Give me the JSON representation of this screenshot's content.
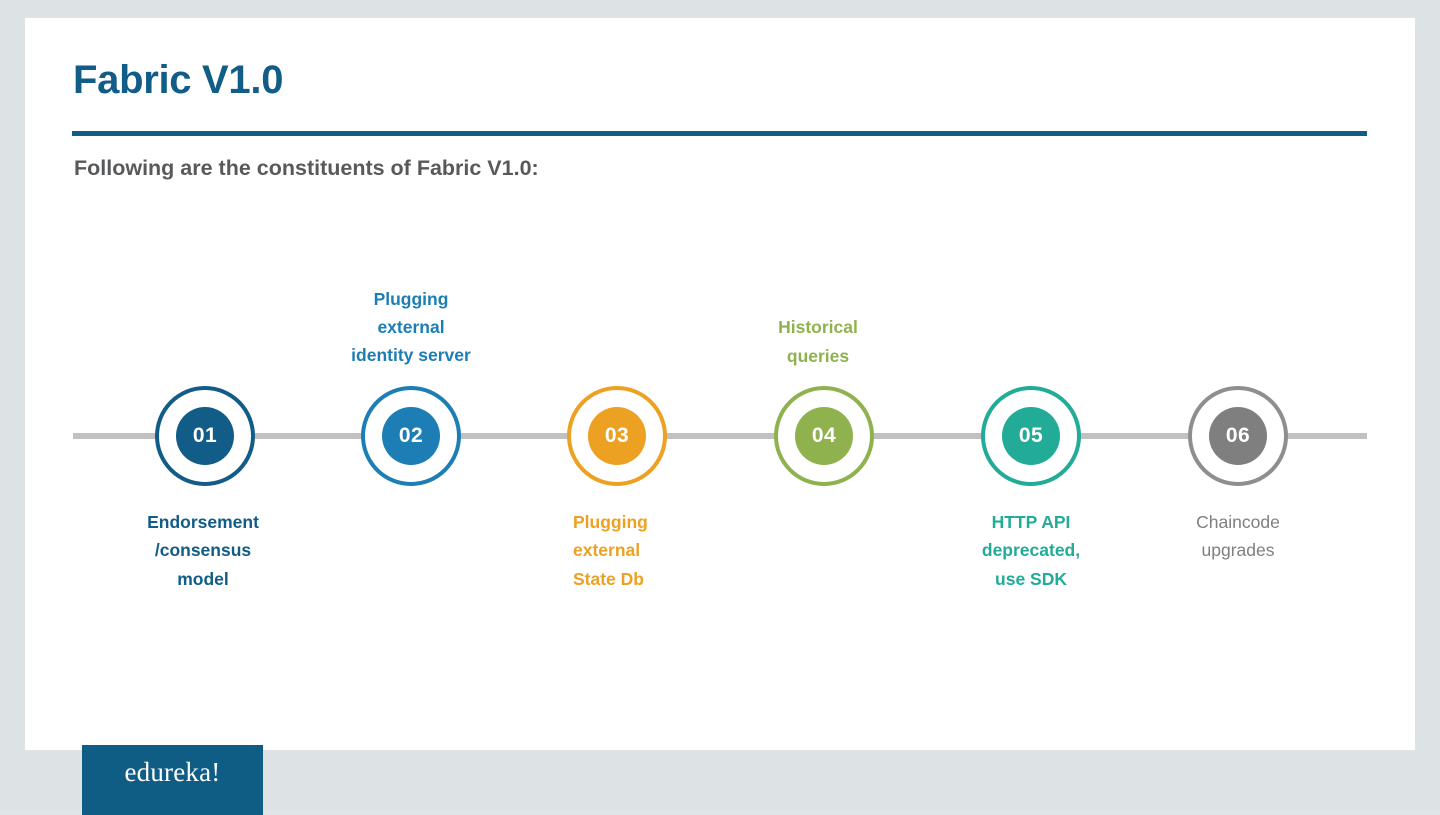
{
  "slide": {
    "title": "Fabric V1.0",
    "subtitle": "Following are the constituents of Fabric V1.0:",
    "title_color": "#115d87",
    "subtitle_color": "#58595b",
    "background_color": "#dde3e5",
    "canvas_color": "#ffffff",
    "connector_color": "#c1c1c1"
  },
  "logo": {
    "text": "edureka!",
    "background_color": "#0f5c85",
    "text_color": "#ffffff"
  },
  "timeline": {
    "nodes": [
      {
        "number": "01",
        "color": "#115d87",
        "ring_color": "#115d87",
        "caption": "Endorsement\n/consensus\nmodel",
        "caption_position": "below",
        "caption_align": "center",
        "caption_weight": "bold"
      },
      {
        "number": "02",
        "color": "#1c7eb5",
        "ring_color": "#1c7eb5",
        "caption": "Plugging\nexternal\nidentity server",
        "caption_position": "above",
        "caption_align": "center",
        "caption_weight": "bold"
      },
      {
        "number": "03",
        "color": "#eda122",
        "ring_color": "#eda122",
        "caption": "Plugging\nexternal\nState Db",
        "caption_position": "below",
        "caption_align": "left",
        "caption_weight": "bold"
      },
      {
        "number": "04",
        "color": "#8fb24f",
        "ring_color": "#8fb24f",
        "caption": "Historical\nqueries",
        "caption_position": "above",
        "caption_align": "center",
        "caption_weight": "bold"
      },
      {
        "number": "05",
        "color": "#22ab97",
        "ring_color": "#22ab97",
        "caption": "HTTP API\ndeprecated,\nuse SDK",
        "caption_position": "below",
        "caption_align": "center",
        "caption_weight": "bold"
      },
      {
        "number": "06",
        "color": "#7f7f7f",
        "ring_color": "#8e8e8e",
        "caption": "Chaincode\nupgrades",
        "caption_position": "below",
        "caption_align": "center",
        "caption_weight": "normal"
      }
    ]
  }
}
